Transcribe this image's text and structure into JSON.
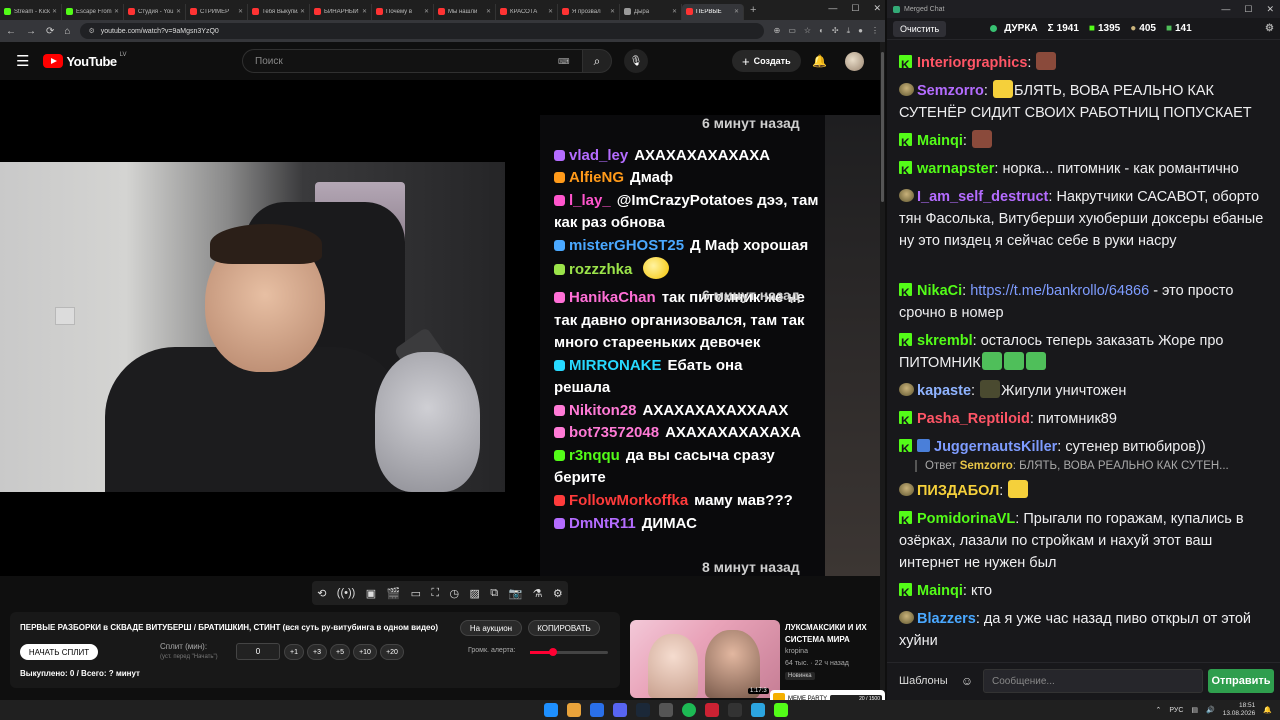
{
  "browser": {
    "tabs": [
      {
        "label": "Stream - Kick",
        "color": "#53fc18"
      },
      {
        "label": "Escape From Tarkov",
        "color": "#53fc18"
      },
      {
        "label": "Студия - YouTube",
        "color": "#ff3333"
      },
      {
        "label": "СТРИМЕР",
        "color": "#ff3333"
      },
      {
        "label": "Тебя Выкупили",
        "color": "#ff3333"
      },
      {
        "label": "БИНАРНЫЙ",
        "color": "#ff3333"
      },
      {
        "label": "Почему в",
        "color": "#ff3333"
      },
      {
        "label": "Мы нашли",
        "color": "#ff3333"
      },
      {
        "label": "КРАСОТА",
        "color": "#ff3333"
      },
      {
        "label": "Я прозвал",
        "color": "#ff3333"
      },
      {
        "label": "Дыра",
        "color": "#999999"
      },
      {
        "label": "ПЕРВЫЕ",
        "color": "#ff3333",
        "active": true
      }
    ],
    "url": "youtube.com/watch?v=9aMgsn3YzQ0"
  },
  "youtube": {
    "logo_text": "YouTube",
    "logo_country": "LV",
    "search_placeholder": "Поиск",
    "create_label": "Создать"
  },
  "video_chat": {
    "times": [
      "6 минут назад",
      "6 минут назад",
      "8 минут назад"
    ],
    "lines": [
      {
        "user": "vlad_ley",
        "text": "АХАХАХАХАХАХА",
        "color": "#b46cff"
      },
      {
        "user": "AlfieNG",
        "text": "Дмаф",
        "color": "#ff9a1a"
      },
      {
        "user": "l_lay_",
        "text": "@ImCrazyPotatoes дээ, там",
        "color": "#ff55cc"
      },
      {
        "user": "",
        "text": "как раз обнова",
        "color": "#ffffff"
      },
      {
        "user": "misterGHOST25",
        "text": "Д Маф хорошая",
        "color": "#4aa8ff"
      },
      {
        "user": "rozzzhka",
        "text": "",
        "color": "#9be34a"
      },
      {
        "user": "HanikaChan",
        "text": "так питомник же не",
        "color": "#ff6fd6"
      },
      {
        "user": "",
        "text": "так давно организовался, там так",
        "color": "#ffffff"
      },
      {
        "user": "",
        "text": "много старееньких девочек",
        "color": "#ffffff"
      },
      {
        "user": "MIRRONAKE",
        "text": "Ебать она",
        "color": "#27d9ff"
      },
      {
        "user": "",
        "text": "решала",
        "color": "#ffffff"
      },
      {
        "user": "Nikiton28",
        "text": "АХАХАХАХАХХААХ",
        "color": "#ff7ad6"
      },
      {
        "user": "bot73572048",
        "text": "АХАХАХАХАХАХА",
        "color": "#ff7ad6"
      },
      {
        "user": "r3nqqu",
        "text": "да вы сасыча сразу",
        "color": "#53fc18"
      },
      {
        "user": "",
        "text": "берите",
        "color": "#ffffff"
      },
      {
        "user": "FollowMorkoffka",
        "text": "маму мав???",
        "color": "#ff3b3b"
      },
      {
        "user": "DmNtR11",
        "text": "ДИМАС",
        "color": "#b46cff"
      }
    ]
  },
  "split_panel": {
    "title": "ПЕРВЫЕ РАЗБОРКИ в СКВАДЕ ВИТУБЕРШ / БРАТИШКИН, СТИНТ (вся суть ру-витубинга в одном видео)",
    "auction_label": "На аукцион",
    "copy_label": "КОПИРОВАТЬ",
    "start_label": "НАЧАТЬ СПЛИТ",
    "split_label": "Сплит (мин):",
    "split_hint": "(уст. перед \"Начать\")",
    "split_value": "0",
    "increments": [
      "+1",
      "+3",
      "+5",
      "+10",
      "+20"
    ],
    "alert_label": "Громк. алерта:",
    "alert_volume": 0.3,
    "status": "Выкуплено: 0 / Всего: ? минут"
  },
  "recommended": {
    "title": "ЛУКСМАКСИКИ И ИХ СИСТЕМА МИРА",
    "channel": "kropina",
    "meta": "64 тыс. · 22 ч назад",
    "badge": "Новинка",
    "duration": "1:17:3"
  },
  "meme_widget": {
    "label": "MEME PARTY",
    "progress": "20 / 1500"
  },
  "merged_chat": {
    "app_title": "Merged Chat",
    "clear_label": "Очистить",
    "channel_name": "ДУРКА",
    "stats": [
      {
        "icon": "sigma",
        "value": "1941"
      },
      {
        "icon": "kick",
        "value": "1395"
      },
      {
        "icon": "badge",
        "value": "405"
      },
      {
        "icon": "kick-green",
        "value": "141"
      }
    ],
    "messages": [
      {
        "user": "Interiorgraphics",
        "text": "",
        "color": "#ff5566",
        "src": "kick",
        "emote": "#8a4a3b"
      },
      {
        "user": "Semzorro",
        "text": "БЛЯТЬ, ВОВА РЕАЛЬНО КАК СУТЕНЁР СИДИТ СВОИХ РАБОТНИЦ ПОПУСКАЕТ",
        "color": "#b46cff",
        "src": "badge",
        "emote": "#f5d03b"
      },
      {
        "user": "Mainqi",
        "text": "",
        "color": "#53fc18",
        "src": "kick",
        "emote": "#8a4a3b"
      },
      {
        "user": "warnapster",
        "text": "норка... питомник - как романтично",
        "color": "#53fc18",
        "src": "kick"
      },
      {
        "user": "I_am_self_destruct",
        "text": "Накрутчики САСАВОТ, оборто тян Фасолька, Витуберши хуюберши доксеры ебаные ну это пиздец я сейчас себе в руки насру",
        "color": "#b46cff",
        "src": "badge"
      },
      {
        "user": "NikaCi",
        "text": "- это просто срочно в номер",
        "link": "https://t.me/bankrollo/64866",
        "color": "#53fc18",
        "src": "kick"
      },
      {
        "user": "skrembl",
        "text": "осталось теперь заказать Жоре про ПИТОМНИК",
        "color": "#53fc18",
        "src": "kick",
        "emote": "#4fbf5a"
      },
      {
        "user": "kapaste",
        "text": "Жигули уничтожен",
        "color": "#8fb3ff",
        "src": "badge",
        "emote": "#4a4a30"
      },
      {
        "user": "Pasha_Reptiloid",
        "text": "питомник89",
        "color": "#ff5566",
        "src": "kick"
      },
      {
        "user": "JuggernautsKiller",
        "text": "сутенер витюбиров))",
        "color": "#7e9cff",
        "src": "kick"
      },
      {
        "user": "ПИЗДАБОЛ",
        "text": "",
        "color": "#f5d03b",
        "src": "badge",
        "emote": "#f5d03b"
      },
      {
        "user": "PomidorinaVL",
        "text": "Прыгали по горажам, купались в озёрках, лазали по стройкам и нахуй этот ваш интернет не нужен был",
        "color": "#53fc18",
        "src": "kick"
      },
      {
        "user": "Mainqi",
        "text": "кто",
        "color": "#53fc18",
        "src": "kick"
      },
      {
        "user": "Blazzers",
        "text": "да я уже час назад пиво открыл от этой хуйни",
        "color": "#4aa8ff",
        "src": "badge"
      }
    ],
    "reply": {
      "prefix": "Ответ",
      "user": "Semzorro",
      "text": "БЛЯТЬ, ВОВА РЕАЛЬНО КАК СУТЕН..."
    },
    "templates_label": "Шаблоны",
    "input_placeholder": "Сообщение...",
    "send_label": "Отправить"
  },
  "taskbar": {
    "lang": "РУС",
    "time": "18:51",
    "date": "13.08.2026"
  }
}
